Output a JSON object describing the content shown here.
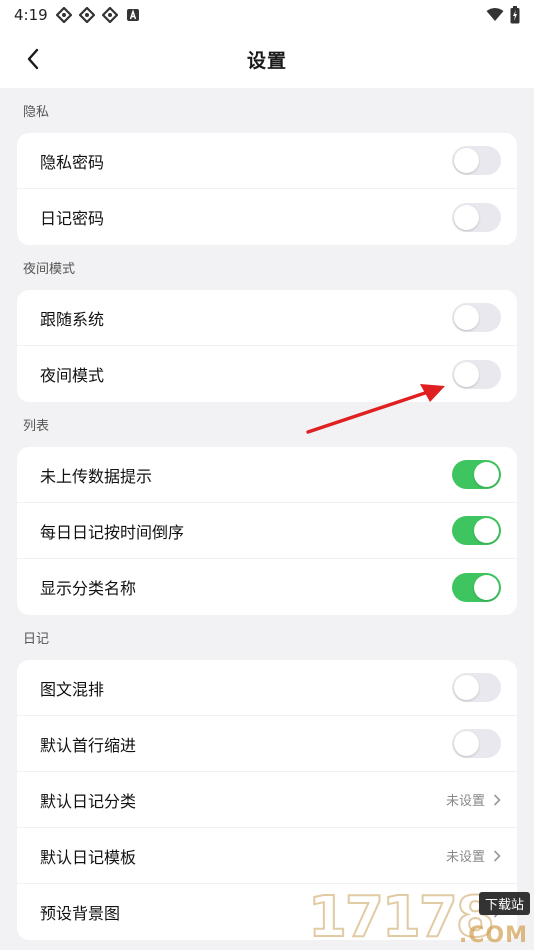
{
  "status_bar": {
    "time": "4:19",
    "notification_icons": [
      "app-icon",
      "app-icon",
      "app-icon",
      "a-icon"
    ],
    "battery_icon": "battery-charging-icon",
    "wifi_icon": "wifi-icon"
  },
  "header": {
    "title": "设置",
    "back_icon": "chevron-left-icon"
  },
  "sections": {
    "privacy": {
      "label": "隐私",
      "items": [
        {
          "label": "隐私密码",
          "toggle_on": false
        },
        {
          "label": "日记密码",
          "toggle_on": false
        }
      ]
    },
    "night": {
      "label": "夜间模式",
      "items": [
        {
          "label": "跟随系统",
          "toggle_on": false
        },
        {
          "label": "夜间模式",
          "toggle_on": false
        }
      ]
    },
    "list": {
      "label": "列表",
      "items": [
        {
          "label": "未上传数据提示",
          "toggle_on": true
        },
        {
          "label": "每日日记按时间倒序",
          "toggle_on": true
        },
        {
          "label": "显示分类名称",
          "toggle_on": true
        }
      ]
    },
    "diary": {
      "label": "日记",
      "items": [
        {
          "label": "图文混排",
          "toggle_on": false
        },
        {
          "label": "默认首行缩进",
          "toggle_on": false
        },
        {
          "label": "默认日记分类",
          "value": "未设置"
        },
        {
          "label": "默认日记模板",
          "value": "未设置"
        },
        {
          "label": "预设背景图"
        }
      ]
    }
  },
  "colors": {
    "toggle_on": "#3fc55f",
    "toggle_off": "#e8e8ee",
    "background": "#f2f2f4",
    "annotation_arrow": "#e02020"
  },
  "watermark": {
    "digits": "17178",
    "site_badge": "下载站",
    "suffix": ".COM"
  }
}
